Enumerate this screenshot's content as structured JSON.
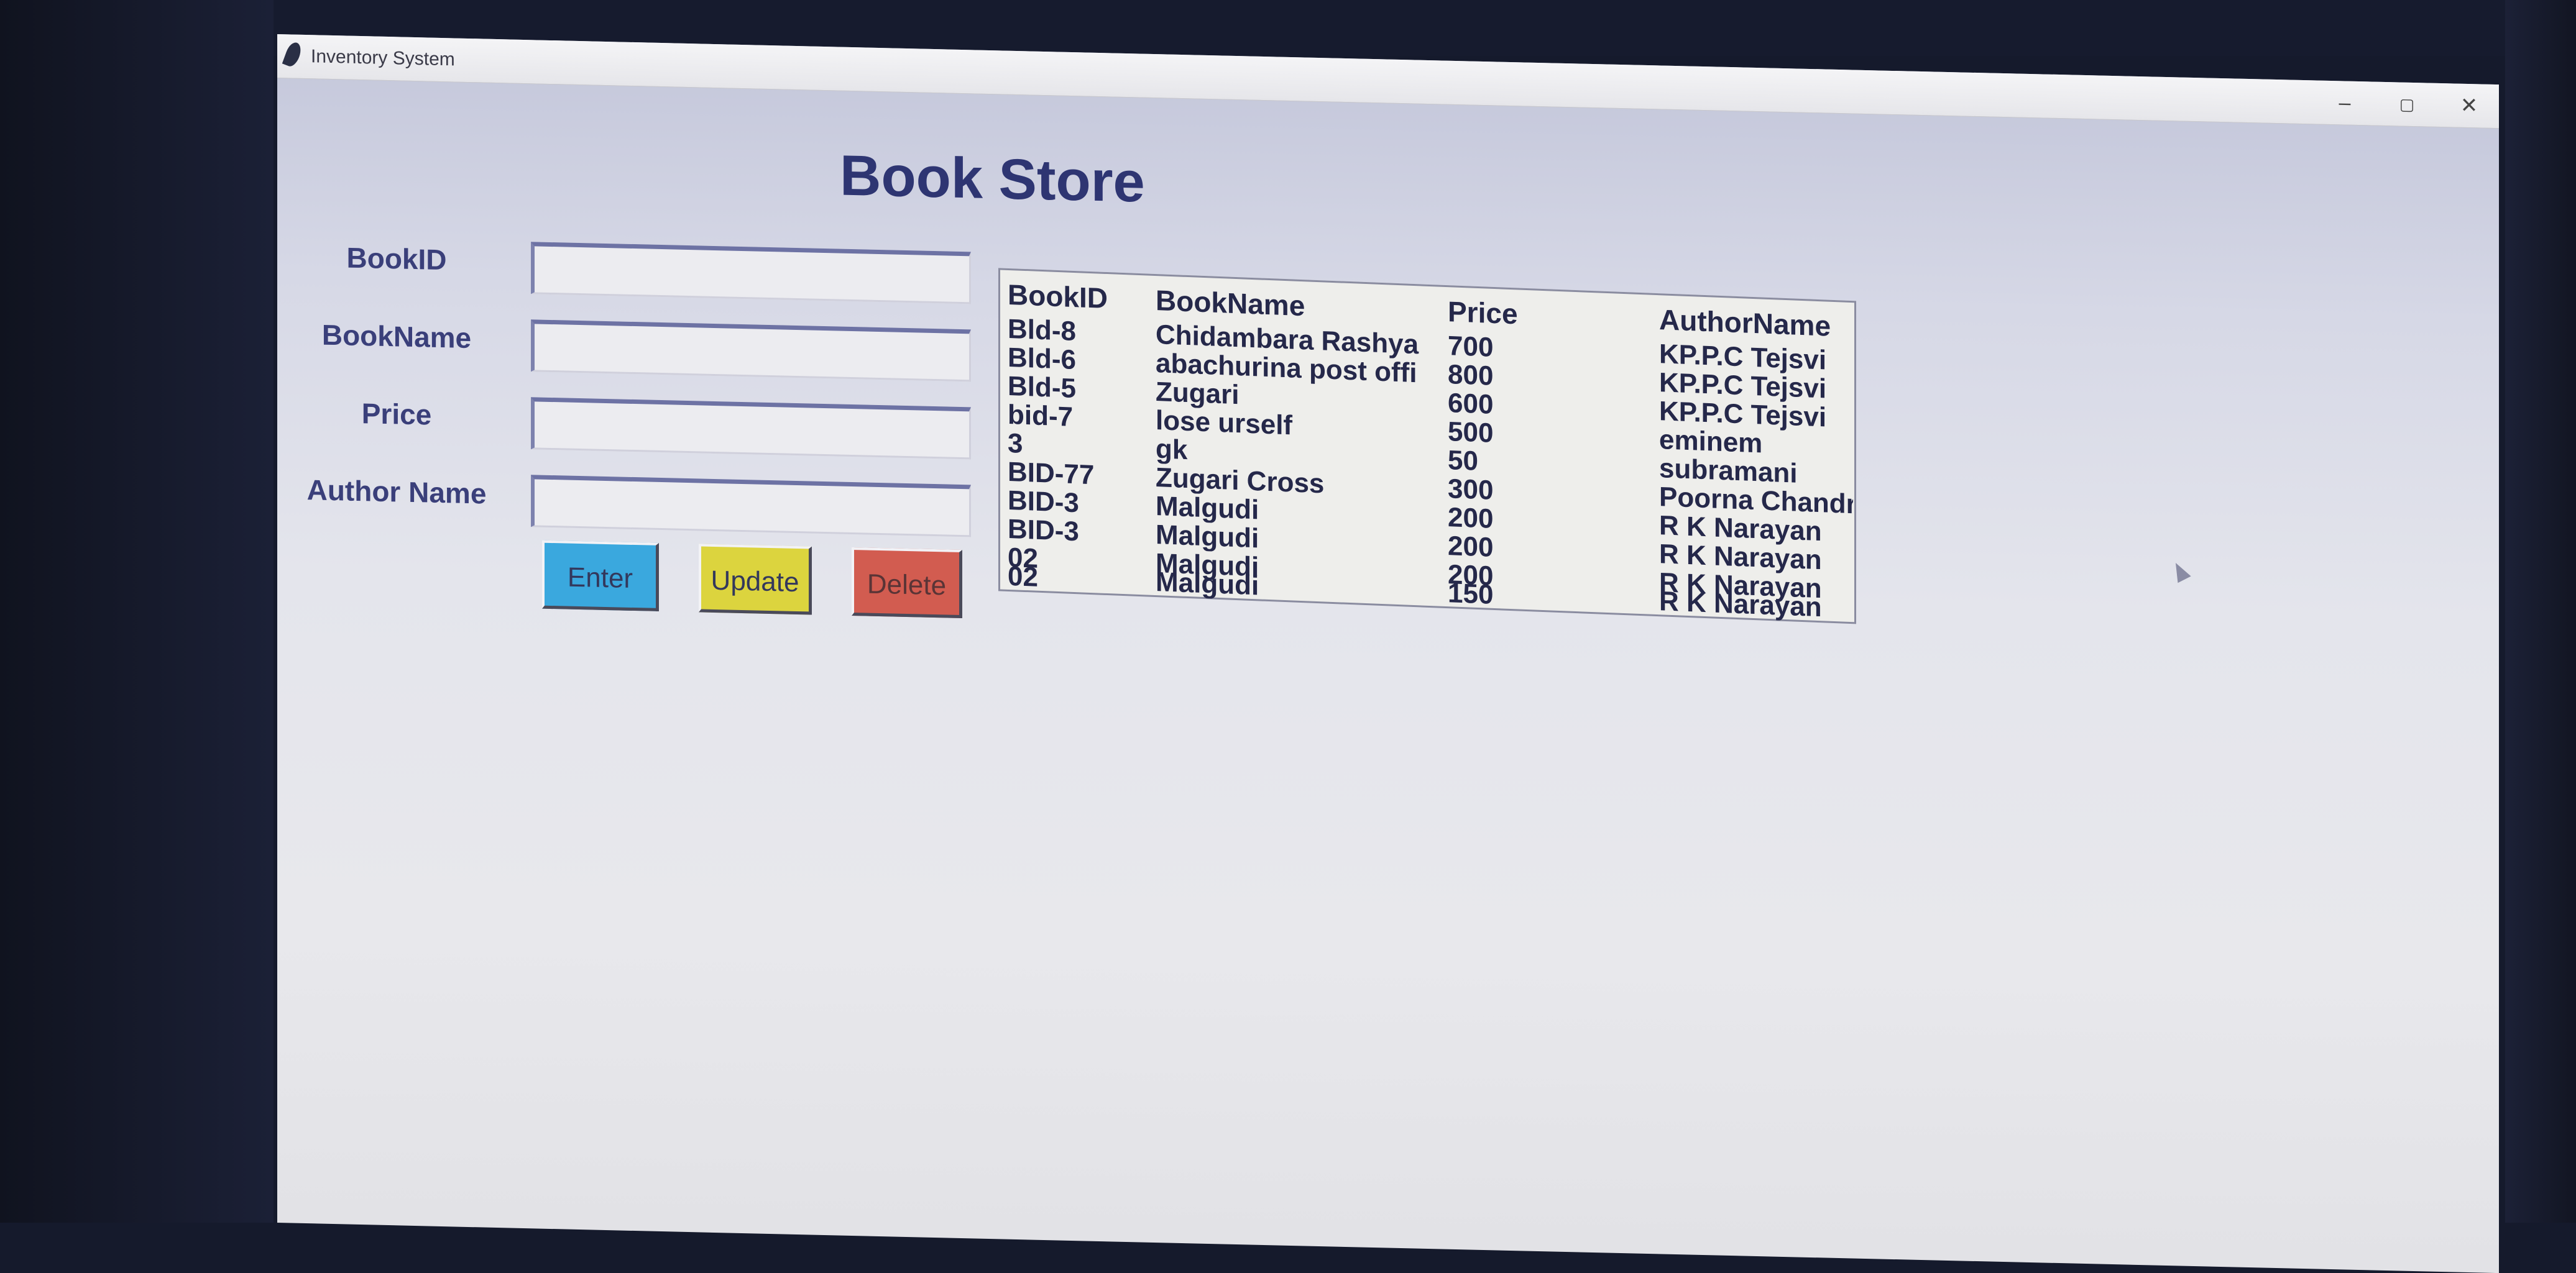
{
  "window": {
    "title": "Inventory System",
    "controls": {
      "minimize": "‒",
      "maximize": "▢",
      "close": "✕"
    }
  },
  "page_title": "Book Store",
  "form": {
    "fields": [
      {
        "label": "BookID",
        "value": ""
      },
      {
        "label": "BookName",
        "value": ""
      },
      {
        "label": "Price",
        "value": ""
      },
      {
        "label": "Author Name",
        "value": ""
      }
    ],
    "buttons": {
      "enter": "Enter",
      "update": "Update",
      "delete": "Delete"
    }
  },
  "table": {
    "headers": [
      "BookID",
      "BookName",
      "Price",
      "AuthorName"
    ],
    "rows": [
      [
        "Bld-8",
        "Chidambara Rashya",
        "700",
        "KP.P.C Tejsvi"
      ],
      [
        "Bld-6",
        "abachurina post offi",
        "800",
        "KP.P.C Tejsvi"
      ],
      [
        "Bld-5",
        "Zugari",
        "600",
        "KP.P.C Tejsvi"
      ],
      [
        "bid-7",
        "lose urself",
        "500",
        "eminem"
      ],
      [
        "3",
        "gk",
        "50",
        "subramani"
      ],
      [
        "BID-77",
        "Zugari Cross",
        "300",
        "Poorna Chandr"
      ],
      [
        "BID-3",
        "Malgudi",
        "200",
        "R K Narayan"
      ],
      [
        "BID-3",
        "Malgudi",
        "200",
        "R K Narayan"
      ],
      [
        "02",
        "Malgudi",
        "200",
        "R K Narayan"
      ],
      [
        "02",
        "Malgudi",
        "150",
        "R K Narayan"
      ]
    ]
  },
  "colors": {
    "title_text": "#2e3572",
    "enter_button": "#3aa8de",
    "update_button": "#dcd43e",
    "delete_button": "#d25c50"
  }
}
